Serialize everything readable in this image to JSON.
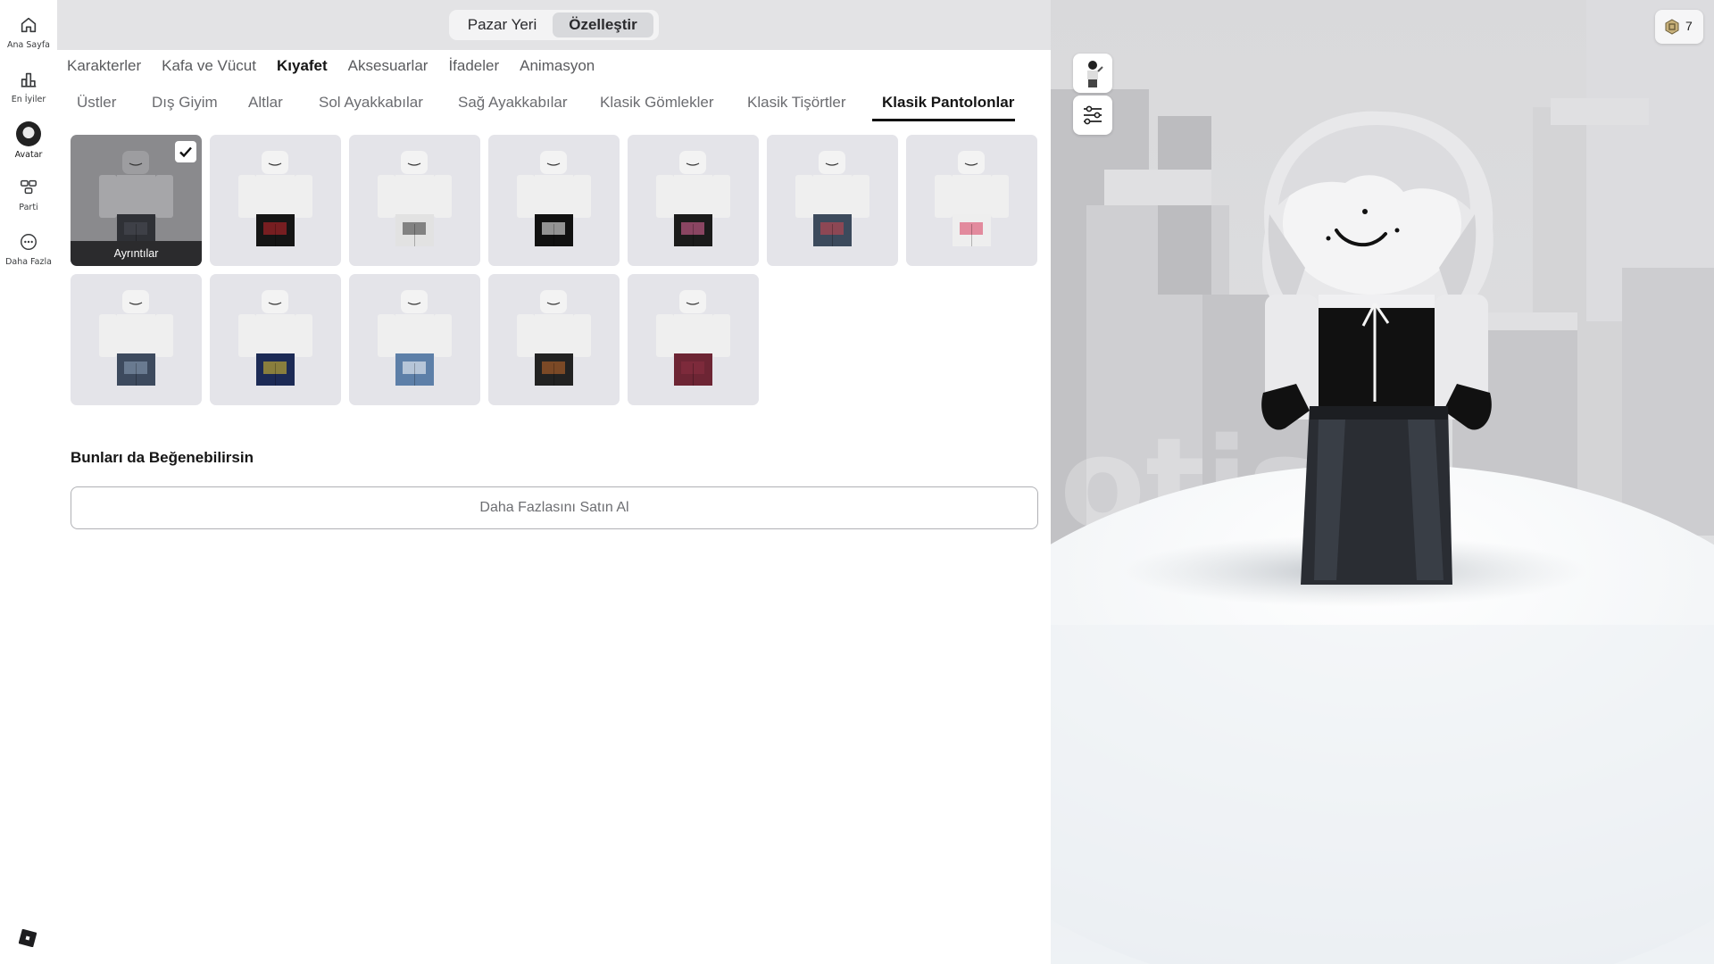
{
  "sidebar": {
    "items": [
      {
        "label": "Ana Sayfa",
        "icon": "home-icon"
      },
      {
        "label": "En İyiler",
        "icon": "chart-icon"
      },
      {
        "label": "Avatar",
        "icon": "avatar-icon"
      },
      {
        "label": "Parti",
        "icon": "party-icon"
      },
      {
        "label": "Daha Fazla",
        "icon": "more-icon"
      }
    ],
    "logo_icon": "roblox-logo-icon"
  },
  "segment": {
    "marketplace": "Pazar Yeri",
    "customize": "Özelleştir",
    "selected": "Özelleştir"
  },
  "categories": [
    "Karakterler",
    "Kafa ve Vücut",
    "Kıyafet",
    "Aksesuarlar",
    "İfadeler",
    "Animasyon"
  ],
  "active_category": "Kıyafet",
  "subcategories": [
    "Üstler",
    "Dış Giyim",
    "Altlar",
    "Sol Ayakkabılar",
    "Sağ Ayakkabılar",
    "Klasik Gömlekler",
    "Klasik Tişörtler",
    "Klasik Pantolonlar"
  ],
  "active_subcategory": "Klasik Pantolonlar",
  "items": [
    {
      "pants": "#2f3136",
      "accent": "#4a4d55",
      "selected": true
    },
    {
      "pants": "#151515",
      "accent": "#c8262c"
    },
    {
      "pants": "#e2e2e2",
      "accent": "#333333"
    },
    {
      "pants": "#111111",
      "accent": "#ffffff"
    },
    {
      "pants": "#1b1b1b",
      "accent": "#e5679d"
    },
    {
      "pants": "#3c4a5c",
      "accent": "#d0454f"
    },
    {
      "pants": "#eeeeee",
      "accent": "#d9395b"
    },
    {
      "pants": "#3d4a5e",
      "accent": "#8ea2ba"
    },
    {
      "pants": "#1c2a55",
      "accent": "#e3c22a"
    },
    {
      "pants": "#5d7fa8",
      "accent": "#ffffff"
    },
    {
      "pants": "#222222",
      "accent": "#c46a2a"
    },
    {
      "pants": "#6d2534",
      "accent": "#8a3042"
    }
  ],
  "selected_item_label": "Ayrıntılar",
  "section_title": "Bunları da Beğenebilirsin",
  "buy_more_label": "Daha Fazlasını Satın Al",
  "scene": {
    "pose_button_icon": "pose-icon",
    "settings_button_icon": "sliders-icon",
    "robux_icon": "robux-icon",
    "robux_amount": "7"
  }
}
